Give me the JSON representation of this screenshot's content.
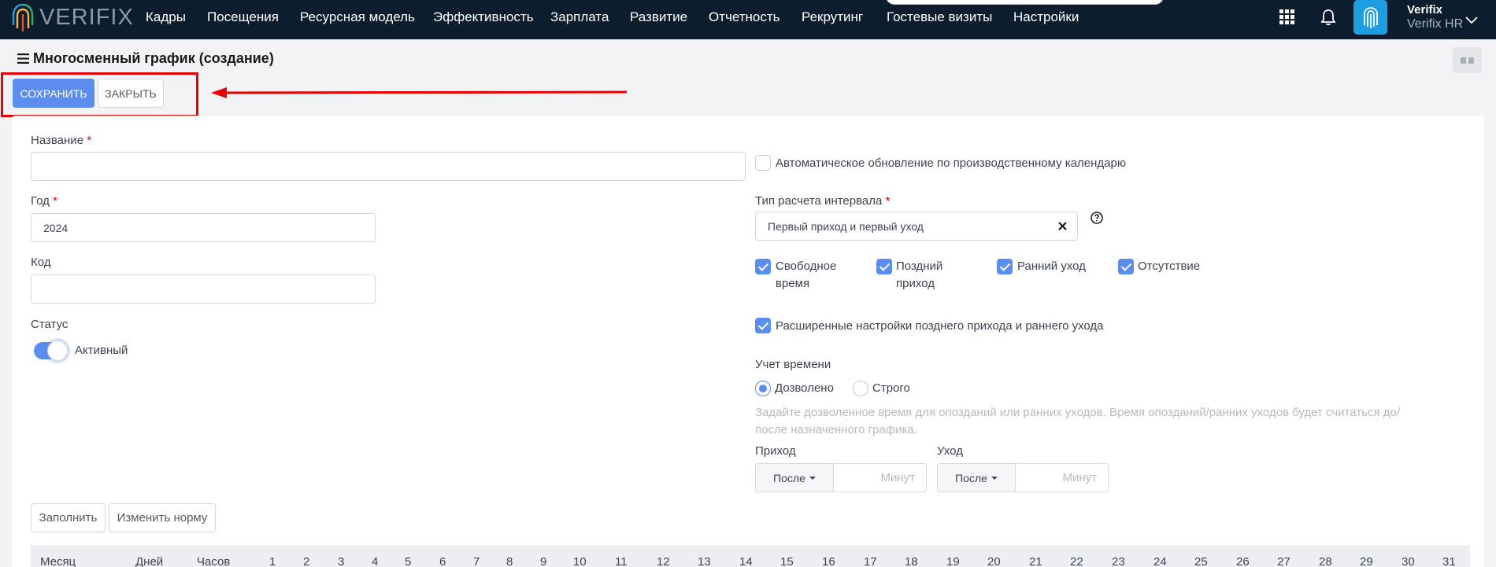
{
  "navbar": {
    "logo_text": "VERIFIX",
    "items": [
      "Кадры",
      "Посещения",
      "Ресурсная модель",
      "Эффективность",
      "Зарплата",
      "Развитие",
      "Отчетность",
      "Рекрутинг",
      "Гостевые визиты",
      "Настройки"
    ],
    "user_name": "Verifix",
    "user_sub": "Verifix HR"
  },
  "page": {
    "title": "Многосменный график (создание)"
  },
  "toolbar": {
    "save_label": "СОХРАНИТЬ",
    "close_label": "ЗАКРЫТЬ"
  },
  "form": {
    "name_label": "Название",
    "name_value": "",
    "year_label": "Год",
    "year_value": "2024",
    "code_label": "Код",
    "code_value": "",
    "status_label": "Статус",
    "status_value": "Активный",
    "auto_update_label": "Автоматическое обновление по производственному календарю",
    "interval_type_label": "Тип расчета интервала",
    "interval_type_value": "Первый приход и первый уход",
    "checks": [
      {
        "label_1": "Свободное",
        "label_2": "время",
        "checked": true
      },
      {
        "label_1": "Поздний",
        "label_2": "приход",
        "checked": true
      },
      {
        "label_1": "Ранний уход",
        "label_2": "",
        "checked": true
      },
      {
        "label_1": "Отсутствие",
        "label_2": "",
        "checked": true
      }
    ],
    "advanced_label": "Расширенные настройки позднего прихода и раннего ухода",
    "time_accounting_label": "Учет времени",
    "radio_allowed": "Дозволено",
    "radio_strict": "Строго",
    "hint_1": "Задайте дозволенное время для опозданий или ранних уходов. Время опозданий/ранних уходов будет считаться до/",
    "hint_2": "после назначенного графика.",
    "arrival_label": "Приход",
    "departure_label": "Уход",
    "after_label": "После",
    "minutes_placeholder": "Минут"
  },
  "actions": {
    "fill_label": "Заполнить",
    "change_norm_label": "Изменить норму"
  },
  "table": {
    "columns": [
      "Месяц",
      "Дней",
      "Часов"
    ],
    "days": [
      "1",
      "2",
      "3",
      "4",
      "5",
      "6",
      "7",
      "8",
      "9",
      "10",
      "11",
      "12",
      "13",
      "14",
      "15",
      "16",
      "17",
      "18",
      "19",
      "20",
      "21",
      "22",
      "23",
      "24",
      "25",
      "26",
      "27",
      "28",
      "29",
      "30",
      "31"
    ]
  }
}
